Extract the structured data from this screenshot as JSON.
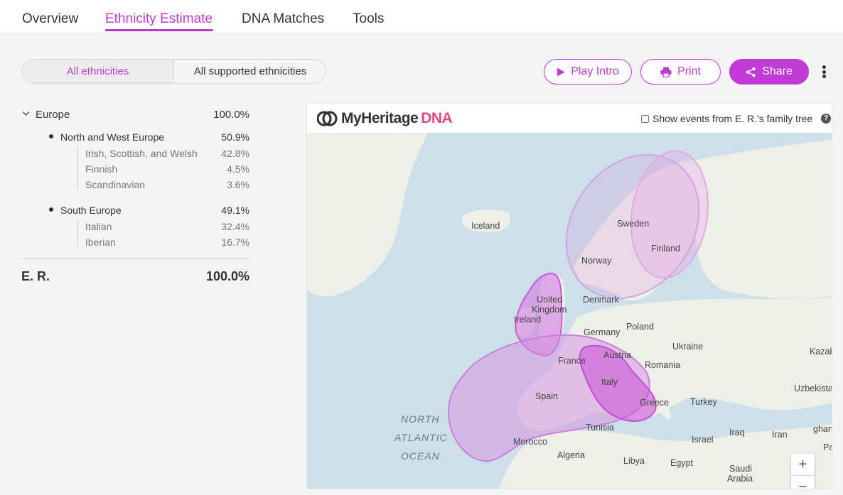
{
  "nav": {
    "tabs": [
      {
        "label": "Overview"
      },
      {
        "label": "Ethnicity Estimate",
        "active": true
      },
      {
        "label": "DNA Matches"
      },
      {
        "label": "Tools"
      }
    ]
  },
  "filter": {
    "options": [
      "All ethnicities",
      "All supported ethnicities"
    ],
    "selected": "All ethnicities"
  },
  "actions": {
    "play_label": "Play Intro",
    "print_label": "Print",
    "share_label": "Share"
  },
  "colors": {
    "accent": "#c23ad6",
    "region_fill": "#d48fe0",
    "logo_dna": "#e8457b"
  },
  "ethnicity": {
    "region": {
      "name": "Europe",
      "percent": "100.0%"
    },
    "groups": [
      {
        "name": "North and West Europe",
        "percent": "50.9%",
        "items": [
          {
            "name": "Irish, Scottish, and Welsh",
            "percent": "42.8%"
          },
          {
            "name": "Finnish",
            "percent": "4.5%"
          },
          {
            "name": "Scandinavian",
            "percent": "3.6%"
          }
        ]
      },
      {
        "name": "South Europe",
        "percent": "49.1%",
        "items": [
          {
            "name": "Italian",
            "percent": "32.4%"
          },
          {
            "name": "Iberian",
            "percent": "16.7%"
          }
        ]
      }
    ],
    "total": {
      "name": "E. R.",
      "percent": "100.0%"
    }
  },
  "map": {
    "logo_main": "MyHeritage",
    "logo_dna": "DNA",
    "checkbox_label": "Show events from E. R.'s family tree",
    "checkbox_checked": false,
    "help_glyph": "?",
    "zoom_in": "+",
    "zoom_out": "−",
    "ocean": [
      "NORTH",
      "ATLANTIC",
      "OCEAN"
    ],
    "labels": [
      "Iceland",
      "Sweden",
      "Finland",
      "Norway",
      "Denmark",
      "United",
      "Kingdom",
      "Ireland",
      "Germany",
      "Poland",
      "Ukraine",
      "France",
      "Austria",
      "Romania",
      "Italy",
      "Spain",
      "Greece",
      "Turkey",
      "Tunisia",
      "Morocco",
      "Algeria",
      "Libya",
      "Egypt",
      "Iraq",
      "Iran",
      "Israel",
      "Saudi",
      "Arabia",
      "Kazak",
      "Uzbekista",
      "ghan",
      "Pa"
    ]
  }
}
